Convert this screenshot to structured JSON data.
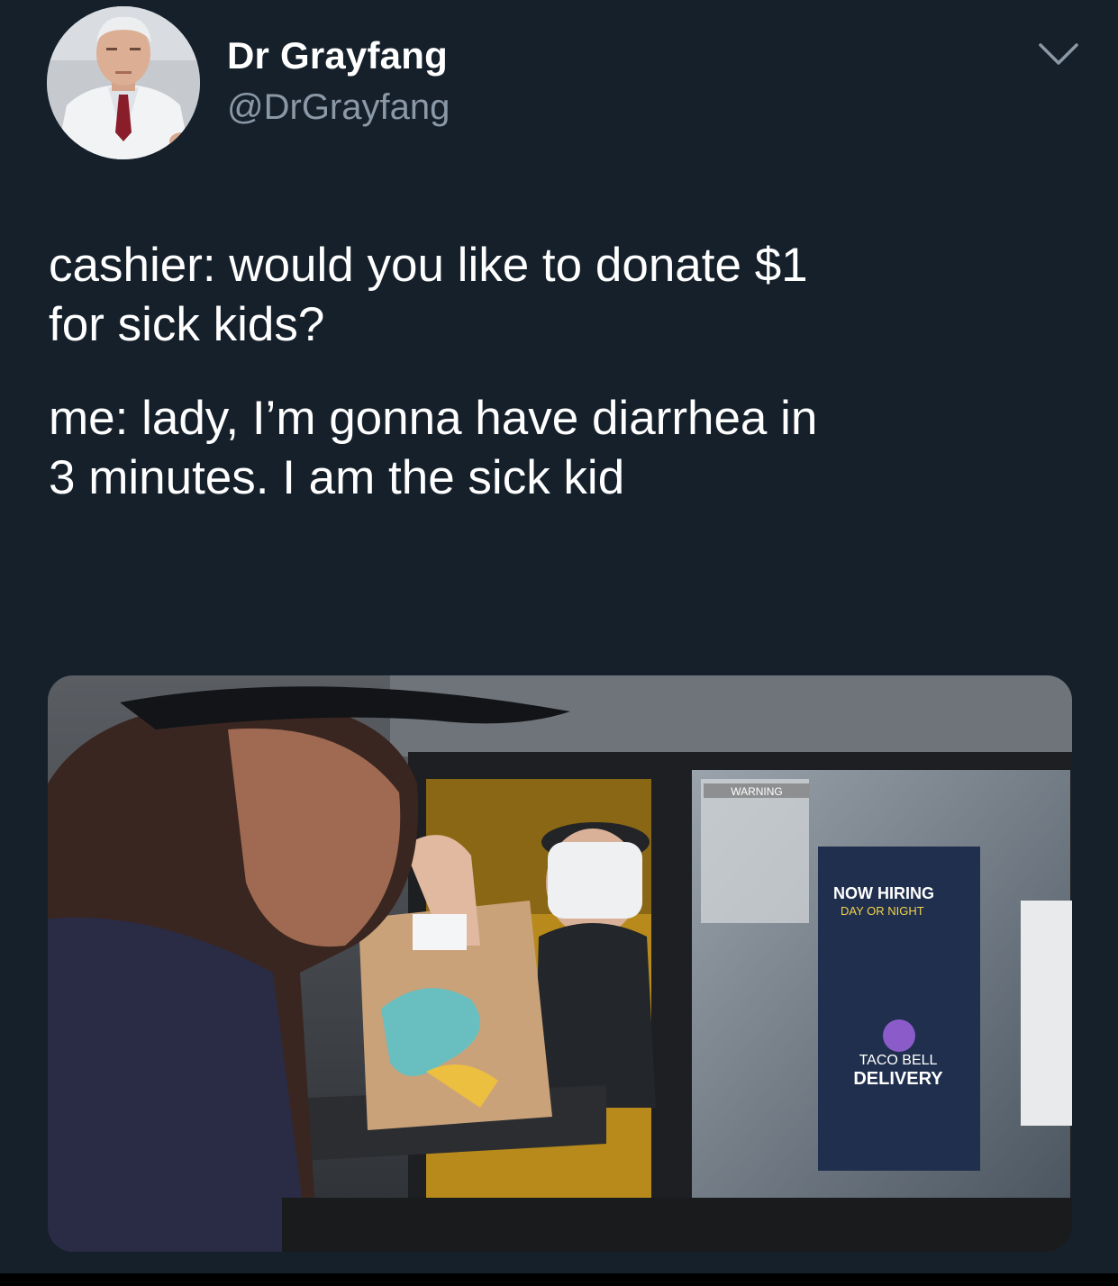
{
  "tweet": {
    "author": {
      "display_name": "Dr Grayfang",
      "handle": "@DrGrayfang",
      "avatar_icon": "avatar-photo"
    },
    "menu_icon": "chevron-down-icon",
    "text_paragraphs": [
      "cashier: would you like to donate $1\nfor sick kids?",
      "me: lady, I’m gonna have diarrhea in\n3 minutes. I am the sick kid"
    ],
    "media": {
      "sign_text": {
        "warning": "WARNING",
        "now_hiring": "NOW HIRING",
        "day_or_night": "DAY OR NIGHT",
        "brand": "TACO BELL",
        "delivery": "DELIVERY"
      }
    }
  },
  "colors": {
    "background": "#15202b",
    "text": "#ffffff",
    "secondary_text": "#8b98a5"
  }
}
